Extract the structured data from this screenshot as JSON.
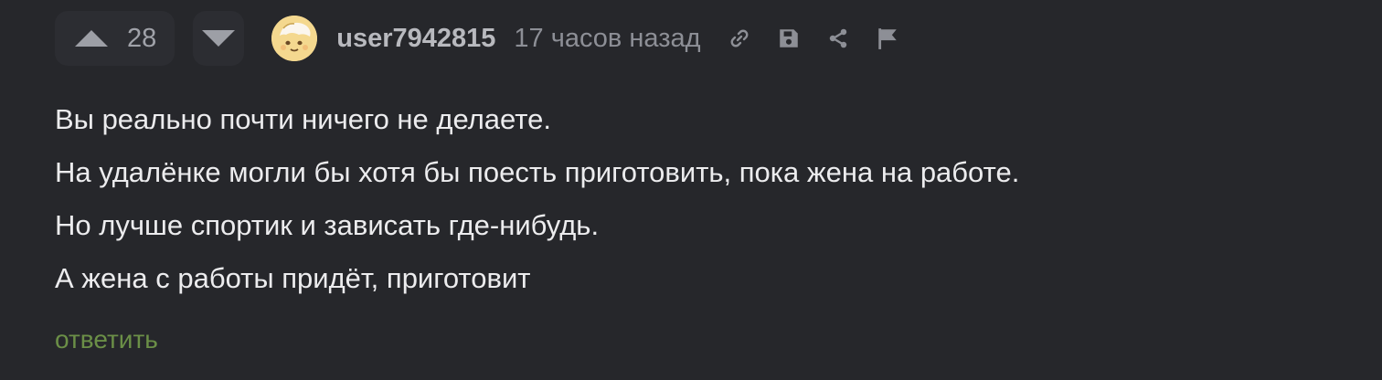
{
  "comment": {
    "rating": "28",
    "username": "user7942815",
    "time": "17 часов назад",
    "icons": {
      "upvote": "arrow-up-icon",
      "downvote": "arrow-down-icon",
      "link": "link-icon",
      "save": "save-icon",
      "share": "share-icon",
      "report": "flag-icon"
    },
    "lines": [
      "Вы реально почти ничего не делаете.",
      "На удалёнке могли бы хотя бы поесть приготовить, пока жена на работе.",
      "Но лучше спортик и зависать где-нибудь.",
      "А жена с работы придёт, приготовит"
    ],
    "reply_label": "ответить"
  },
  "colors": {
    "background": "#26272b",
    "button_bg": "#2c2d32",
    "reply": "#6b8f47"
  }
}
